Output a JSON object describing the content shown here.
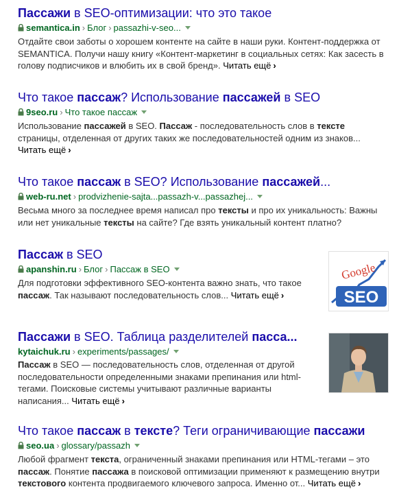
{
  "results": [
    {
      "title": [
        {
          "t": "Пассажи",
          "b": true
        },
        {
          "t": " в SEO-оптимизации: что это такое",
          "b": false
        }
      ],
      "domain": "semantica.in",
      "breadcrumbs": [
        "Блог",
        "passazhi-v-seo..."
      ],
      "snippet": [
        {
          "t": "Отдайте свои заботы о хорошем контенте на сайте в наши руки. Контент-поддержка от SEMANTICA. Получи нашу книгу «Контент-маркетинг в социальных сетях: Как засесть в голову подписчиков и влюбить их в свой бренд». ",
          "b": false
        }
      ],
      "read_more": "Читать ещё"
    },
    {
      "title": [
        {
          "t": "Что такое ",
          "b": false
        },
        {
          "t": "пассаж",
          "b": true
        },
        {
          "t": "? Использование ",
          "b": false
        },
        {
          "t": "пассажей",
          "b": true
        },
        {
          "t": " в SEO",
          "b": false
        }
      ],
      "domain": "9seo.ru",
      "breadcrumbs": [
        "Что такое пассаж"
      ],
      "snippet": [
        {
          "t": "Использование ",
          "b": false
        },
        {
          "t": "пассажей",
          "b": true
        },
        {
          "t": " в SEO. ",
          "b": false
        },
        {
          "t": "Пассаж",
          "b": true
        },
        {
          "t": " - последовательность слов в ",
          "b": false
        },
        {
          "t": "тексте",
          "b": true
        },
        {
          "t": " страницы, отделенная от других таких же последовательностей одним из знаков...",
          "b": false
        }
      ],
      "read_more": "Читать ещё"
    },
    {
      "title": [
        {
          "t": "Что такое ",
          "b": false
        },
        {
          "t": "пассаж",
          "b": true
        },
        {
          "t": " в SEO? Использование ",
          "b": false
        },
        {
          "t": "пассажей",
          "b": true
        },
        {
          "t": "...",
          "b": false
        }
      ],
      "domain": "web-ru.net",
      "breadcrumbs": [
        "prodvizhenie-sajta...passazh-v...passazhej..."
      ],
      "snippet": [
        {
          "t": "Весьма много за последнее время написал про ",
          "b": false
        },
        {
          "t": "тексты",
          "b": true
        },
        {
          "t": " и про их уникальность: Важны или нет уникальные ",
          "b": false
        },
        {
          "t": "тексты",
          "b": true
        },
        {
          "t": " на сайте? Где взять уникальный контент платно?",
          "b": false
        }
      ],
      "read_more": ""
    },
    {
      "title": [
        {
          "t": "Пассаж",
          "b": true
        },
        {
          "t": " в SEO",
          "b": false
        }
      ],
      "domain": "apanshin.ru",
      "breadcrumbs": [
        "Блог",
        "Пассаж в SEO"
      ],
      "snippet": [
        {
          "t": "Для подготовки эффективного SEO-контента важно знать, что такое ",
          "b": false
        },
        {
          "t": "пассаж",
          "b": true
        },
        {
          "t": ". Так называют последовательность слов... ",
          "b": false
        }
      ],
      "read_more": "Читать ещё",
      "thumbnail": {
        "kind": "seo-graph",
        "word1": "Google",
        "word2": "SEO"
      }
    },
    {
      "title": [
        {
          "t": "Пассажи",
          "b": true
        },
        {
          "t": " в SEO. Таблица разделителей ",
          "b": false
        },
        {
          "t": "пасса...",
          "b": true
        }
      ],
      "domain": "kytaichuk.ru",
      "breadcrumbs": [
        "experiments/passages/"
      ],
      "snippet": [
        {
          "t": "Пассаж",
          "b": true
        },
        {
          "t": " в SEO — последовательность слов, отделенная от другой последовательности определенными знаками препинания или html-тегами. Поисковые системы учитывают различные варианты написания... ",
          "b": false
        }
      ],
      "read_more": "Читать ещё",
      "thumbnail": {
        "kind": "person-photo"
      }
    },
    {
      "title": [
        {
          "t": "Что такое ",
          "b": false
        },
        {
          "t": "пассаж",
          "b": true
        },
        {
          "t": " в ",
          "b": false
        },
        {
          "t": "тексте",
          "b": true
        },
        {
          "t": "? Теги ограничивающие ",
          "b": false
        },
        {
          "t": "пассажи",
          "b": true
        }
      ],
      "domain": "seo.ua",
      "breadcrumbs": [
        "glossary/passazh"
      ],
      "snippet": [
        {
          "t": "Любой фрагмент ",
          "b": false
        },
        {
          "t": "текста",
          "b": true
        },
        {
          "t": ", ограниченный знаками препинания или HTML-тегами – это ",
          "b": false
        },
        {
          "t": "пассаж",
          "b": true
        },
        {
          "t": ". Понятие ",
          "b": false
        },
        {
          "t": "пассажа",
          "b": true
        },
        {
          "t": " в поисковой оптимизации применяют к размещению внутри ",
          "b": false
        },
        {
          "t": "текстового",
          "b": true
        },
        {
          "t": " контента продвигаемого ключевого запроса. Именно от... ",
          "b": false
        }
      ],
      "read_more": "Читать ещё"
    }
  ]
}
